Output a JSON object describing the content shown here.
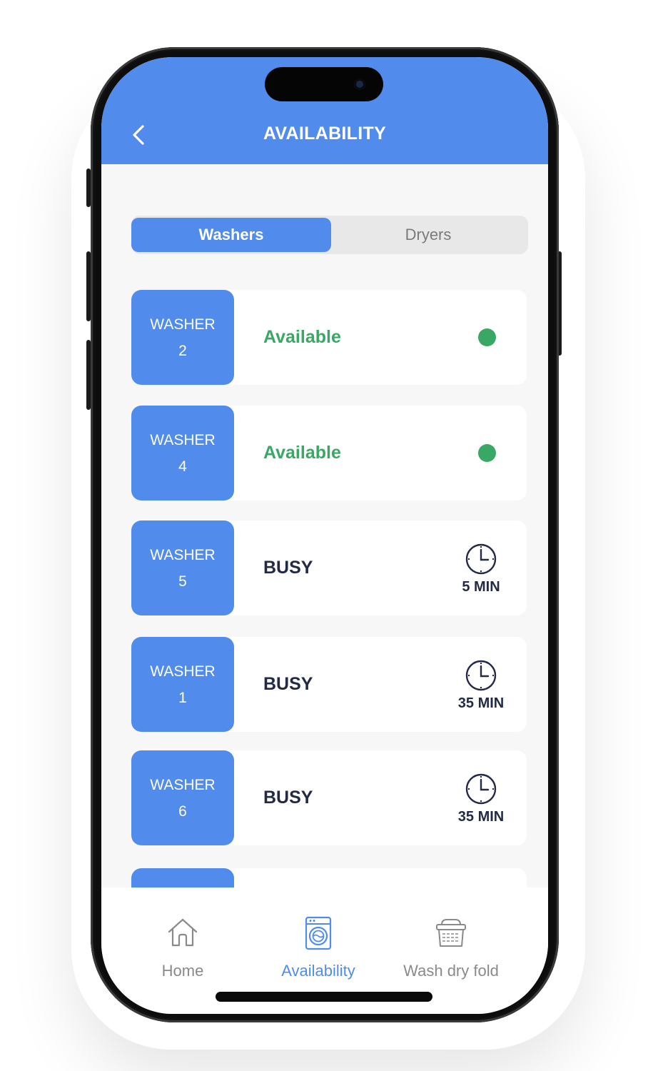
{
  "header": {
    "title": "AVAILABILITY",
    "back_icon": "chevron-left-icon"
  },
  "segment": {
    "tabs": [
      {
        "label": "Washers",
        "active": true
      },
      {
        "label": "Dryers",
        "active": false
      }
    ]
  },
  "machines": [
    {
      "name": "WASHER",
      "number": "2",
      "status": "Available",
      "indicator": "green-dot"
    },
    {
      "name": "WASHER",
      "number": "4",
      "status": "Available",
      "indicator": "green-dot"
    },
    {
      "name": "WASHER",
      "number": "5",
      "status": "BUSY",
      "time": "5 MIN",
      "indicator": "clock-icon"
    },
    {
      "name": "WASHER",
      "number": "1",
      "status": "BUSY",
      "time": "35 MIN",
      "indicator": "clock-icon"
    },
    {
      "name": "WASHER",
      "number": "6",
      "status": "BUSY",
      "time": "35 MIN",
      "indicator": "clock-icon"
    }
  ],
  "tabbar": {
    "items": [
      {
        "label": "Home",
        "icon": "home-icon",
        "active": false
      },
      {
        "label": "Availability",
        "icon": "washing-machine-icon",
        "active": true
      },
      {
        "label": "Wash dry fold",
        "icon": "laundry-basket-icon",
        "active": false
      }
    ]
  },
  "colors": {
    "primary": "#518cec",
    "available": "#3aa865",
    "busy_text": "#232a45",
    "background": "#f7f7f7"
  }
}
